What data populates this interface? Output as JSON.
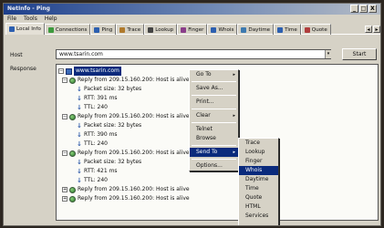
{
  "window": {
    "title": "NetInfo - Ping",
    "controls": [
      "_",
      "□",
      "X"
    ]
  },
  "menubar": [
    "File",
    "Tools",
    "Help"
  ],
  "tabs": [
    {
      "label": "Local Info",
      "icon": "info-icon",
      "color": "#2c5fb0"
    },
    {
      "label": "Connections",
      "icon": "connections-icon",
      "color": "#3d9a3d"
    },
    {
      "label": "Ping",
      "icon": "ping-icon",
      "color": "#2c5fb0"
    },
    {
      "label": "Trace",
      "icon": "trace-icon",
      "color": "#b07a2c"
    },
    {
      "label": "Lookup",
      "icon": "lookup-icon",
      "color": "#444444"
    },
    {
      "label": "Finger",
      "icon": "finger-icon",
      "color": "#8a3d8a"
    },
    {
      "label": "Whois",
      "icon": "whois-icon",
      "color": "#2c5fb0"
    },
    {
      "label": "Daytime",
      "icon": "daytime-icon",
      "color": "#3d7ab0"
    },
    {
      "label": "Time",
      "icon": "time-icon",
      "color": "#2c5fb0"
    },
    {
      "label": "Quote",
      "icon": "quote-icon",
      "color": "#b03d3d"
    }
  ],
  "host": {
    "label": "Host",
    "value": "www.tsarin.com"
  },
  "start_label": "Start",
  "response_label": "Response",
  "response": {
    "root": "www.tsarin.com",
    "replies": [
      {
        "text": "Reply from 209.15.160.200: Host is alive",
        "packet": "Packet size: 32 bytes",
        "rtt": "RTT: 391 ms",
        "ttl": "TTL: 240"
      },
      {
        "text": "Reply from 209.15.160.200: Host is alive",
        "packet": "Packet size: 32 bytes",
        "rtt": "RTT: 390 ms",
        "ttl": "TTL: 240"
      },
      {
        "text": "Reply from 209.15.160.200: Host is alive",
        "packet": "Packet size: 32 bytes",
        "rtt": "RTT: 421 ms",
        "ttl": "TTL: 240"
      }
    ],
    "tail": [
      "Reply from 209.15.160.200: Host is alive",
      "Reply from 209.15.160.200: Host is alive"
    ]
  },
  "context_menu": {
    "items": [
      "Go To",
      "Save As...",
      "Print...",
      "Clear",
      "Telnet",
      "Browse",
      "Send To",
      "Options..."
    ],
    "has_submenu": [
      "Go To",
      "Clear",
      "Send To"
    ],
    "highlighted": "Send To"
  },
  "submenu": {
    "items": [
      "Trace",
      "Lookup",
      "Finger",
      "Whois",
      "Daytime",
      "Time",
      "Quote",
      "HTML",
      "Services"
    ],
    "highlighted": "Whois"
  }
}
